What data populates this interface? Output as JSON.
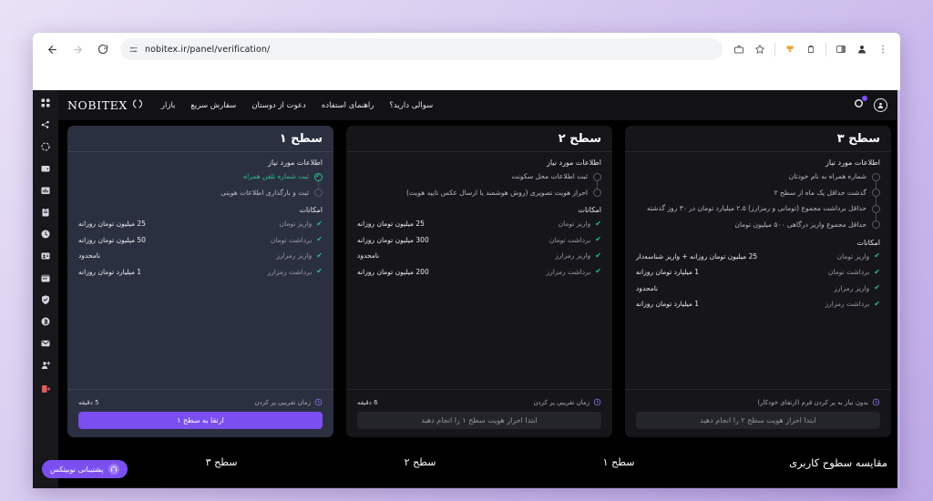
{
  "browser": {
    "url": "nobitex.ir/panel/verification/",
    "back_label": "←",
    "forward_label": "→",
    "reload_label": "⟳",
    "site_info_icon": "tune-icon",
    "actions": [
      "share-icon",
      "bookmark-star-icon",
      "extension-puzzle-icon",
      "extension-icon",
      "side-panel-icon",
      "profile-icon",
      "chrome-menu-icon"
    ]
  },
  "navbar": {
    "brand": "NOBITEX",
    "links": [
      {
        "label": "بازار"
      },
      {
        "label": "سفارش سریع"
      },
      {
        "label": "دعوت از دوستان"
      },
      {
        "label": "راهنمای استفاده"
      },
      {
        "label": "سوالی دارید؟"
      }
    ],
    "avatar_icon": "user-circle-icon",
    "notification_icon": "notification-icon"
  },
  "rail": {
    "items": [
      {
        "icon": "dashboard-grid-icon"
      },
      {
        "icon": "network-share-icon"
      },
      {
        "icon": "circle-dashed-icon"
      },
      {
        "icon": "wallet-icon"
      },
      {
        "icon": "bar-chart-icon"
      },
      {
        "icon": "clipboard-icon"
      },
      {
        "icon": "history-clock-icon"
      },
      {
        "icon": "id-card-icon"
      },
      {
        "icon": "calendar-icon"
      },
      {
        "icon": "shield-check-icon"
      },
      {
        "icon": "bitcoin-coin-icon"
      },
      {
        "icon": "envelope-icon"
      },
      {
        "icon": "add-user-icon"
      },
      {
        "icon": "logout-icon"
      }
    ]
  },
  "sections": {
    "requirements_label": "اطلاعات مورد نیاز",
    "features_label": "امکانات",
    "time_label": "زمان تقریبی پر کردن"
  },
  "cards": [
    {
      "id": "level-3",
      "title": "سطح ۳",
      "active": false,
      "requirements": [
        {
          "text": "شماره همراه به نام خودتان",
          "done": false
        },
        {
          "text": "گذشت حداقل یک ماه از سطح ۲",
          "done": false
        },
        {
          "text": "حداقل برداشت مجموع (تومانی و رمزارز) ۲.۵ میلیارد تومان در ۳۰ روز گذشته",
          "done": false
        },
        {
          "text": "حداقل مجموع واریز درگاهی ۵۰۰ میلیون تومان",
          "done": false
        }
      ],
      "features": [
        {
          "name": "واریز تومان",
          "value": "25 میلیون تومان روزانه + واریز شناسه‌دار"
        },
        {
          "name": "برداشت تومان",
          "value": "1 میلیارد تومان روزانه"
        },
        {
          "name": "واریز رمزارز",
          "value": "نامحدود"
        },
        {
          "name": "برداشت رمزارز",
          "value": "1 میلیارد تومان روزانه"
        }
      ],
      "time_value": "بدون نیاز به پر کردن فرم (ارتقای خودکار)",
      "cta_label": "ابتدا احراز هویت سطح ۲ را انجام دهید",
      "cta_enabled": false
    },
    {
      "id": "level-2",
      "title": "سطح ۲",
      "active": false,
      "requirements": [
        {
          "text": "ثبت اطلاعات محل سکونت",
          "done": false
        },
        {
          "text": "احراز هویت تصویری (روش هوشمند یا ارسال عکس تایید هویت)",
          "done": false
        }
      ],
      "features": [
        {
          "name": "واریز تومان",
          "value": "25 میلیون تومان روزانه"
        },
        {
          "name": "برداشت تومان",
          "value": "300 میلیون تومان روزانه"
        },
        {
          "name": "واریز رمزارز",
          "value": "نامحدود"
        },
        {
          "name": "برداشت رمزارز",
          "value": "200 میلیون تومان روزانه"
        }
      ],
      "time_value": "6 دقیقه",
      "cta_label": "ابتدا احراز هویت سطح ۱ را انجام دهید",
      "cta_enabled": false
    },
    {
      "id": "level-1",
      "title": "سطح ۱",
      "active": true,
      "requirements": [
        {
          "text": "ثبت شماره تلفن همراه",
          "done": true
        },
        {
          "text": "ثبت و بارگذاری اطلاعات هویتی",
          "done": false
        }
      ],
      "features": [
        {
          "name": "واریز تومان",
          "value": "25 میلیون تومان روزانه"
        },
        {
          "name": "برداشت تومان",
          "value": "50 میلیون تومان روزانه"
        },
        {
          "name": "واریز رمزارز",
          "value": "نامحدود"
        },
        {
          "name": "برداشت رمزارز",
          "value": "1 میلیارد تومان روزانه"
        }
      ],
      "time_value": "5 دقیقه",
      "cta_label": "ارتقا به سطح ۱",
      "cta_enabled": true
    }
  ],
  "bottom": {
    "title": "مقایسه سطوح کاربری",
    "tabs": [
      {
        "label": "سطح ۱"
      },
      {
        "label": "سطح ۲"
      },
      {
        "label": "سطح ۳"
      }
    ]
  },
  "support": {
    "label": "پشتیبانی نوبیتکس",
    "icon": "headset-icon"
  },
  "colors": {
    "accent": "#7b4ef0",
    "success": "#2bbf8a",
    "card_active_bg": "#2b3040",
    "card_bg": "#16161a",
    "page_bg": "#000000"
  }
}
